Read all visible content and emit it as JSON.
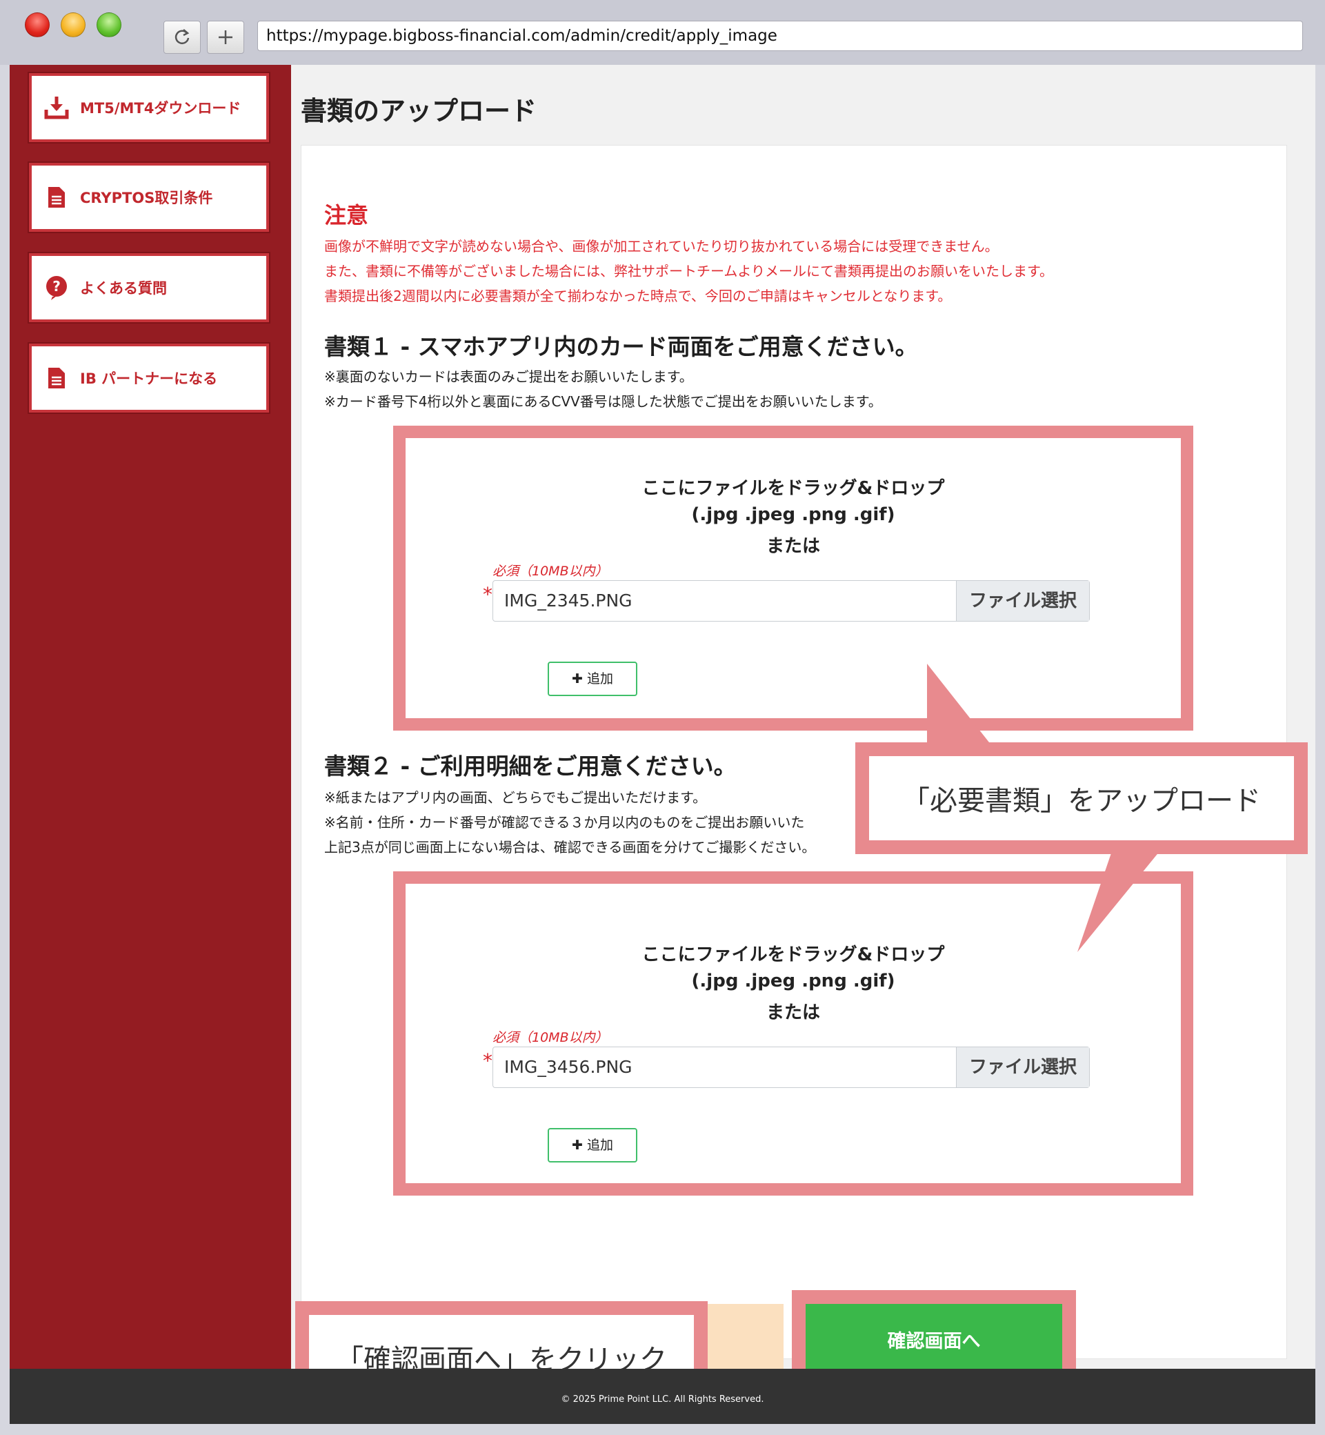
{
  "browser": {
    "url": "https://mypage.bigboss-financial.com/admin/credit/apply_image"
  },
  "sidebar": {
    "items": [
      {
        "label": "MT5/MT4ダウンロード",
        "icon": "download-icon"
      },
      {
        "label": "CRYPTOS取引条件",
        "icon": "document-icon"
      },
      {
        "label": "よくある質問",
        "icon": "question-icon"
      },
      {
        "label": "IB パートナーになる",
        "icon": "document-icon"
      }
    ]
  },
  "page": {
    "title": "書類のアップロード"
  },
  "notice": {
    "title": "注意",
    "lines": [
      "画像が不鮮明で文字が読めない場合や、画像が加工されていたり切り抜かれている場合には受理できません。",
      "また、書類に不備等がございました場合には、弊社サポートチームよりメールにて書類再提出のお願いをいたします。",
      "書類提出後2週間以内に必要書類が全て揃わなかった時点で、今回のご申請はキャンセルとなります。"
    ]
  },
  "section1": {
    "title": "書類１ - スマホアプリ内のカード両面をご用意ください。",
    "notes": [
      "※裏面のないカードは表面のみご提出をお願いいたします。",
      "※カード番号下4桁以外と裏面にあるCVV番号は隠した状態でご提出をお願いいたします。"
    ],
    "drop_line1": "ここにファイルをドラッグ&ドロップ",
    "drop_line2": "(.jpg .jpeg .png .gif)",
    "drop_line3": "または",
    "required_label": "必須（10MB以内）",
    "asterisk": "*",
    "file_name": "IMG_2345.PNG",
    "file_button": "ファイル選択",
    "add_button": "✚ 追加"
  },
  "section2": {
    "title": "書類２ - ご利用明細をご用意ください。",
    "notes": [
      "※紙またはアプリ内の画面、どちらでもご提出いただけます。",
      "※名前・住所・カード番号が確認できる３か月以内のものをご提出お願いいた",
      "上記3点が同じ画面上にない場合は、確認できる画面を分けてご撮影ください。"
    ],
    "drop_line1": "ここにファイルをドラッグ&ドロップ",
    "drop_line2": "(.jpg .jpeg .png .gif)",
    "drop_line3": "または",
    "required_label": "必須（10MB以内）",
    "asterisk": "*",
    "file_name": "IMG_3456.PNG",
    "file_button": "ファイル選択",
    "add_button": "✚ 追加"
  },
  "callouts": {
    "upload": "「必要書類」をアップロード",
    "confirm": "「確認画面へ」をクリック"
  },
  "confirm_button": "確認画面へ",
  "footer": {
    "copyright": "© 2025 Prime Point LLC. All Rights Reserved."
  },
  "colors": {
    "sidebar": "#941c22",
    "accent_red": "#d9262d",
    "callout_pink": "#e88a8e",
    "confirm_green": "#3ab84a"
  }
}
